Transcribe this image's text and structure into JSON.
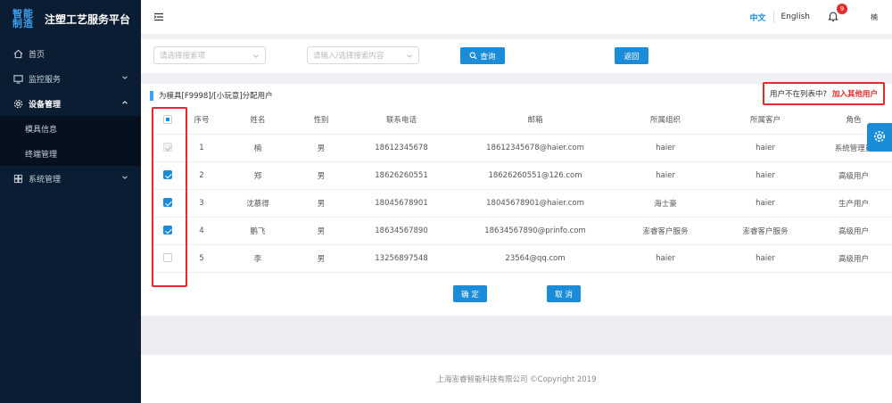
{
  "brand": {
    "logo": "智能制造",
    "title": "注塑工艺服务平台"
  },
  "sidebar": {
    "items": [
      {
        "label": "首页",
        "icon": "home-icon"
      },
      {
        "label": "监控服务",
        "icon": "monitor-icon"
      },
      {
        "label": "设备管理",
        "icon": "gear-icon"
      },
      {
        "label": "系统管理",
        "icon": "grid-icon"
      }
    ],
    "sub_items": [
      {
        "label": "模具信息"
      },
      {
        "label": "终端管理"
      }
    ]
  },
  "header": {
    "lang_zh": "中文",
    "lang_en": "English",
    "notification_count": "9",
    "user": "楠"
  },
  "search": {
    "field_placeholder": "请选择搜索项",
    "content_placeholder": "请输入/选择搜索内容",
    "query_label": "查询",
    "back_label": "返回"
  },
  "panel": {
    "title": "为模具[F9998]/[小玩意]分配用户",
    "not_in_list": "用户不在列表中?",
    "add_other_users": "加入其他用户"
  },
  "table": {
    "columns": [
      "序号",
      "姓名",
      "性别",
      "联系电话",
      "邮箱",
      "所属组织",
      "所属客户",
      "角色"
    ],
    "rows": [
      {
        "state": "disabled",
        "cells": [
          "1",
          "楠",
          "男",
          "18612345678",
          "18612345678@haier.com",
          "haier",
          "haier",
          "系统管理员"
        ]
      },
      {
        "state": "checked",
        "cells": [
          "2",
          "郑",
          "男",
          "18626260551",
          "18626260551@126.com",
          "haier",
          "haier",
          "高级用户"
        ]
      },
      {
        "state": "checked",
        "cells": [
          "3",
          "沈慕得",
          "男",
          "18045678901",
          "18045678901@haier.com",
          "海士豪",
          "haier",
          "生产用户"
        ]
      },
      {
        "state": "checked",
        "cells": [
          "4",
          "鹏飞",
          "男",
          "18634567890",
          "18634567890@prinfo.com",
          "澎睿客户服务",
          "澎睿客户服务",
          "高级用户"
        ]
      },
      {
        "state": "unchecked",
        "cells": [
          "5",
          "李",
          "男",
          "13256897548",
          "23564@qq.com",
          "haier",
          "haier",
          "高级用户"
        ]
      }
    ]
  },
  "actions": {
    "confirm": "确 定",
    "cancel": "取 消"
  },
  "footer": {
    "text": "上海澎睿智能科技有限公司 ©Copyright 2019"
  },
  "colors": {
    "primary": "#1a8cd8",
    "sidebar": "#0b1d33",
    "highlight": "#e32b2b"
  }
}
